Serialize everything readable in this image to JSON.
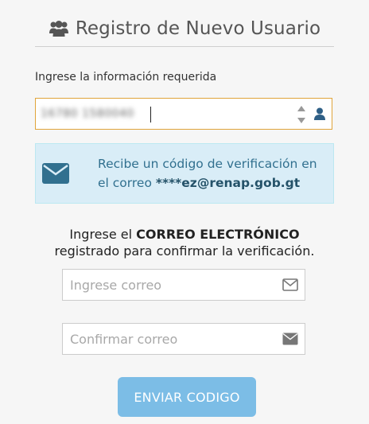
{
  "header": {
    "title": "Registro de Nuevo Usuario",
    "icon": "users-icon"
  },
  "form": {
    "subtitle": "Ingrese la información requerida",
    "id_field": {
      "value": "16780 1580040",
      "icon": "user-icon"
    }
  },
  "alert": {
    "line1": "Recibe un código de verificación en",
    "line2_prefix": "el correo ",
    "email": "****ez@renap.gob.gt",
    "icon": "envelope-icon"
  },
  "instruction": {
    "prefix": "Ingrese el ",
    "bold": "CORREO ELECTRÓNICO",
    "line2": "registrado para confirmar la verificación."
  },
  "email_input": {
    "placeholder": "Ingrese correo",
    "icon": "envelope-outline-icon"
  },
  "confirm_input": {
    "placeholder": "Confirmar correo",
    "icon": "envelope-solid-icon"
  },
  "send_button": {
    "label": "ENVIAR CODIGO"
  },
  "colors": {
    "accent_border": "#e0a43a",
    "alert_bg": "#d9edf7",
    "alert_text": "#31708f",
    "button_bg": "#7cbde6"
  }
}
